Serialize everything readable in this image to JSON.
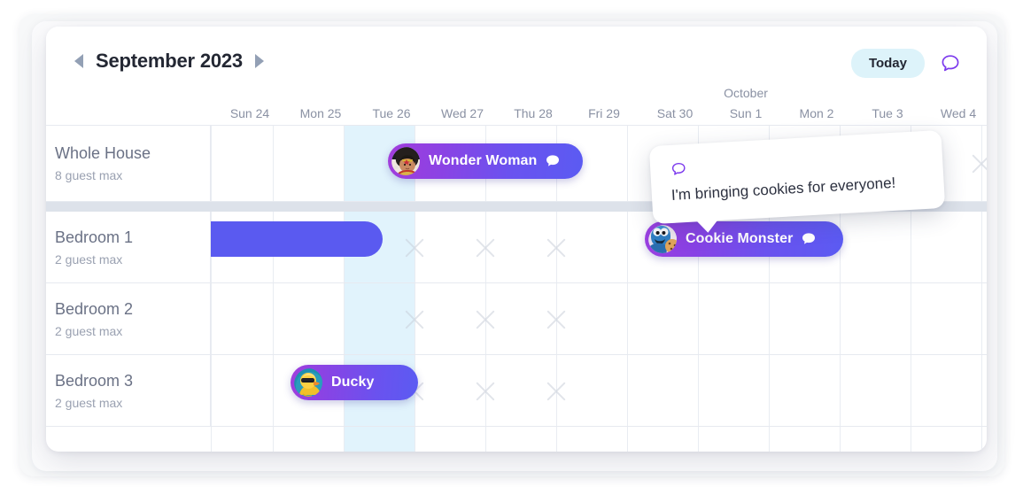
{
  "header": {
    "month_title": "September 2023",
    "prev_label": "Previous month",
    "next_label": "Next month",
    "today_label": "Today",
    "chat_icon": "speech-bubble-icon"
  },
  "days": [
    {
      "label": "Sun 24",
      "month": ""
    },
    {
      "label": "Mon 25",
      "month": ""
    },
    {
      "label": "Tue 26",
      "month": ""
    },
    {
      "label": "Wed 27",
      "month": ""
    },
    {
      "label": "Thu 28",
      "month": ""
    },
    {
      "label": "Fri 29",
      "month": ""
    },
    {
      "label": "Sat 30",
      "month": ""
    },
    {
      "label": "Sun 1",
      "month": "October"
    },
    {
      "label": "Mon 2",
      "month": ""
    },
    {
      "label": "Tue 3",
      "month": ""
    },
    {
      "label": "Wed 4",
      "month": ""
    }
  ],
  "highlighted_day_index": 2,
  "rooms": [
    {
      "name": "Whole House",
      "capacity": "8 guest max"
    },
    {
      "name": "Bedroom 1",
      "capacity": "2 guest max"
    },
    {
      "name": "Bedroom 2",
      "capacity": "2 guest max"
    },
    {
      "name": "Bedroom 3",
      "capacity": "2 guest max"
    }
  ],
  "bookings": [
    {
      "guest": "Wonder Woman",
      "room_index": 0,
      "avatar": "wonder-woman-avatar",
      "has_message": true
    },
    {
      "guest": "Cookie Monster",
      "room_index": 1,
      "avatar": "cookie-monster-avatar",
      "has_message": true
    },
    {
      "guest": "Ducky",
      "room_index": 3,
      "avatar": "ducky-avatar",
      "has_message": false
    }
  ],
  "tooltip": {
    "icon": "speech-bubble-icon",
    "message": "I'm bringing cookies for everyone!"
  },
  "colors": {
    "accent_purple": "#7c3aed",
    "pill_start": "#9b3fe0",
    "pill_end": "#5b5bf2",
    "today_bg": "#ddf3fa",
    "highlight_column": "#dcf1fb",
    "grid_line": "#e7eaf0",
    "row_separator": "#dde2ea",
    "text_dark": "#232733",
    "text_muted": "#8a91a3"
  }
}
